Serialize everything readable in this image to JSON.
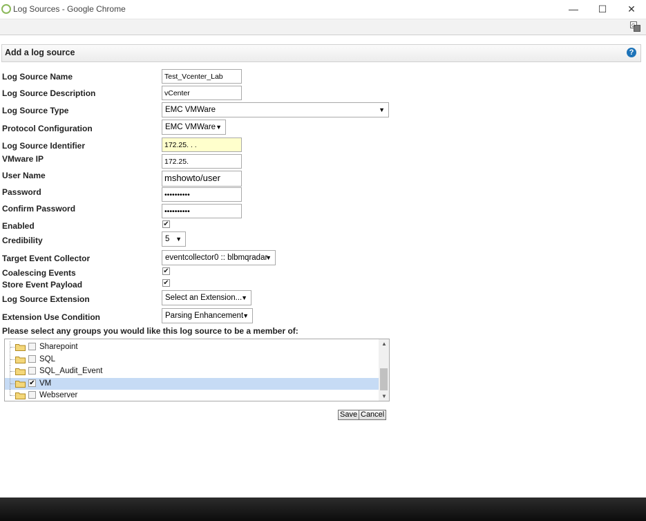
{
  "window": {
    "title": "Log Sources - Google Chrome"
  },
  "icons": {
    "app": "chrome-app-icon",
    "translate": "translate-icon",
    "help": "help-icon",
    "folder": "folder-icon"
  },
  "header": {
    "title": "Add a log source",
    "help": "?"
  },
  "form": {
    "name": {
      "label": "Log Source Name",
      "value": "Test_Vcenter_Lab"
    },
    "description": {
      "label": "Log Source Description",
      "value": "vCenter"
    },
    "type": {
      "label": "Log Source Type",
      "value": "EMC VMWare"
    },
    "protocol": {
      "label": "Protocol Configuration",
      "value": "EMC VMWare"
    },
    "identifier": {
      "label": "Log Source Identifier",
      "value": "172.25.    .   ."
    },
    "vmware_ip": {
      "label": "VMware IP",
      "value": "172.25."
    },
    "username": {
      "label": "User Name",
      "value": "mshowto/user"
    },
    "password": {
      "label": "Password",
      "value": "••••••••••"
    },
    "confirm_password": {
      "label": "Confirm Password",
      "value": "••••••••••"
    },
    "enabled": {
      "label": "Enabled",
      "checked": true
    },
    "credibility": {
      "label": "Credibility",
      "value": "5"
    },
    "collector": {
      "label": "Target Event Collector",
      "value": "eventcollector0 :: blbmqradar"
    },
    "coalescing": {
      "label": "Coalescing Events",
      "checked": true
    },
    "store_payload": {
      "label": "Store Event Payload",
      "checked": true
    },
    "extension": {
      "label": "Log Source Extension",
      "value": "Select an Extension..."
    },
    "use_condition": {
      "label": "Extension Use Condition",
      "value": "Parsing Enhancement"
    }
  },
  "groups": {
    "prompt": "Please select any groups you would like this log source to be a member of:",
    "items": [
      {
        "label": "Sharepoint",
        "checked": false
      },
      {
        "label": "SQL",
        "checked": false
      },
      {
        "label": "SQL_Audit_Event",
        "checked": false
      },
      {
        "label": "VM",
        "checked": true
      },
      {
        "label": "Webserver",
        "checked": false
      }
    ]
  },
  "buttons": {
    "save": "Save",
    "cancel": "Cancel"
  },
  "symbols": {
    "check": "✔",
    "arrow": "▼",
    "up": "▲",
    "down": "▼",
    "minimize": "—",
    "maximize": "☐",
    "close": "✕"
  }
}
